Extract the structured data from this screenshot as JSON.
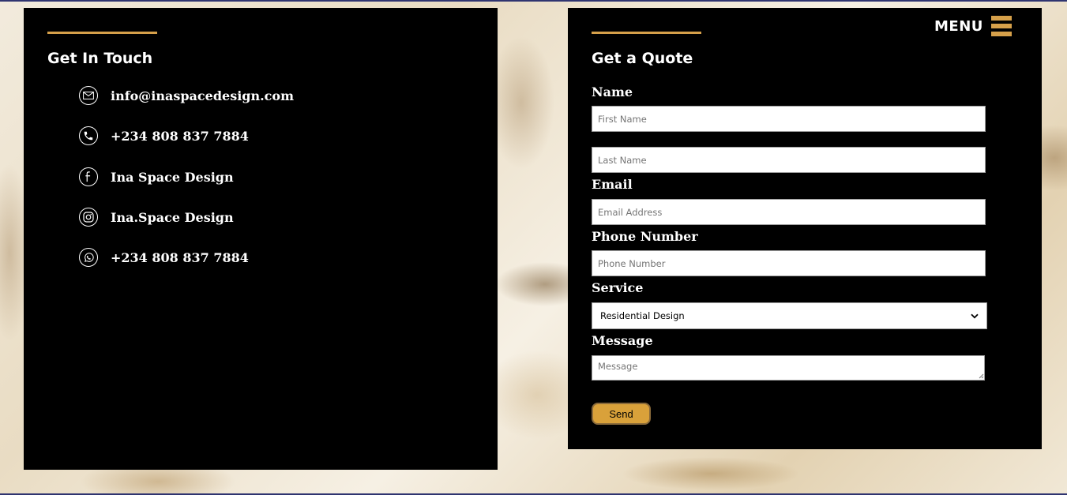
{
  "contact": {
    "heading": "Get In Touch",
    "items": [
      {
        "icon": "mail-icon",
        "text": "info@inaspacedesign.com"
      },
      {
        "icon": "phone-icon",
        "text": "+234 808 837 7884"
      },
      {
        "icon": "facebook-icon",
        "text": "Ina Space Design"
      },
      {
        "icon": "instagram-icon",
        "text": "Ina.Space Design"
      },
      {
        "icon": "whatsapp-icon",
        "text": "+234 808 837 7884"
      }
    ]
  },
  "nav": {
    "menu_label": "MENU",
    "menu_icon": "hamburger-icon"
  },
  "quote_form": {
    "heading": "Get a Quote",
    "name_label": "Name",
    "first_name_placeholder": "First Name",
    "last_name_placeholder": "Last Name",
    "email_label": "Email",
    "email_placeholder": "Email Address",
    "phone_label": "Phone Number",
    "phone_placeholder": "Phone Number",
    "service_label": "Service",
    "service_selected": "Residential Design",
    "message_label": "Message",
    "message_placeholder": "Message",
    "send_label": "Send"
  },
  "colors": {
    "accent": "#d6a04a",
    "panel_background": "#000000",
    "button": "#d9a13a"
  }
}
